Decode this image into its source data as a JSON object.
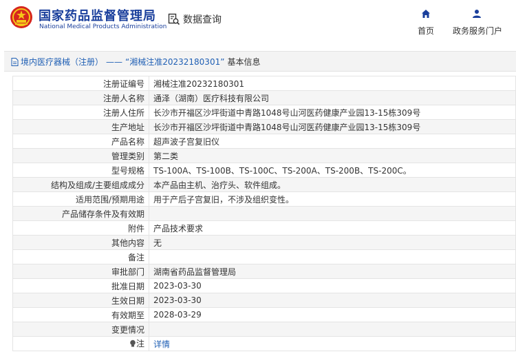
{
  "header": {
    "brand_cn": "国家药品监督管理局",
    "brand_en": "National Medical Products Administration",
    "query_label": "数据查询",
    "nav": [
      {
        "label": "首页",
        "icon": "home-icon"
      },
      {
        "label": "政务服务门户",
        "icon": "user-icon"
      }
    ]
  },
  "breadcrumb": {
    "category": "境内医疗器械（注册）",
    "separator": "——",
    "title": "“湘械注准20232180301”",
    "suffix": "基本信息"
  },
  "rows": [
    {
      "label": "注册证编号",
      "value": "湘械注准20232180301"
    },
    {
      "label": "注册人名称",
      "value": "通泽（湖南）医疗科技有限公司"
    },
    {
      "label": "注册人住所",
      "value": "长沙市开福区沙坪街道中青路1048号山河医药健康产业园13-15栋309号"
    },
    {
      "label": "生产地址",
      "value": "长沙市开福区沙坪街道中青路1048号山河医药健康产业园13-15栋309号"
    },
    {
      "label": "产品名称",
      "value": "超声波子宫复旧仪"
    },
    {
      "label": "管理类别",
      "value": "第二类"
    },
    {
      "label": "型号规格",
      "value": "TS-100A、TS-100B、TS-100C、TS-200A、TS-200B、TS-200C。"
    },
    {
      "label": "结构及组成/主要组成成分",
      "value": "本产品由主机、治疗头、软件组成。"
    },
    {
      "label": "适用范围/预期用途",
      "value": "用于产后子宫复旧，不涉及组织变性。"
    },
    {
      "label": "产品储存条件及有效期",
      "value": ""
    },
    {
      "label": "附件",
      "value": "产品技术要求"
    },
    {
      "label": "其他内容",
      "value": "无"
    },
    {
      "label": "备注",
      "value": ""
    },
    {
      "label": "审批部门",
      "value": "湖南省药品监督管理局"
    },
    {
      "label": "批准日期",
      "value": "2023-03-30"
    },
    {
      "label": "生效日期",
      "value": "2023-03-30"
    },
    {
      "label": "有效期至",
      "value": "2028-03-29"
    },
    {
      "label": "变更情况",
      "value": ""
    }
  ],
  "note_row": {
    "label": "注",
    "link": "详情",
    "icon": "lightbulb-icon"
  },
  "colors": {
    "brand": "#1a3f9c",
    "link": "#1f5fb4",
    "emblem": "#d6261e"
  }
}
